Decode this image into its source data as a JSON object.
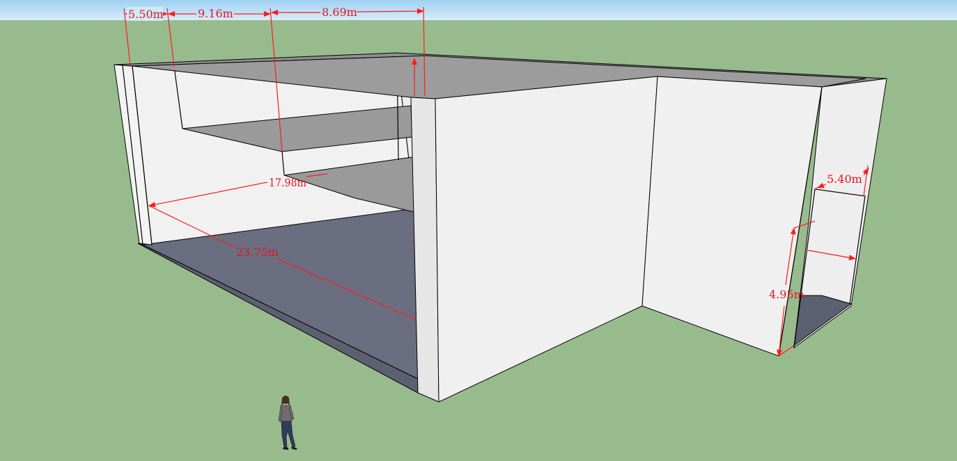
{
  "model": {
    "colors": {
      "sky": "#bfe0f6",
      "ground": "#98bb8e",
      "wall": "#efefef",
      "wall_shade": "#e4e4e4",
      "slab": "#9a9a9a",
      "floor": "#6b6e80",
      "dimension": "#ff1a1a"
    },
    "dimensions": [
      {
        "id": "dim-top-1",
        "label": "5.50m"
      },
      {
        "id": "dim-top-2",
        "label": "9.16m"
      },
      {
        "id": "dim-top-3",
        "label": "8.69m"
      },
      {
        "id": "dim-inner-width",
        "label": "17.98m"
      },
      {
        "id": "dim-inner-length",
        "label": "23.75m"
      },
      {
        "id": "dim-opening-width",
        "label": "5.40m"
      },
      {
        "id": "dim-opening-height",
        "label": "4.95m"
      }
    ],
    "figure": "scale-figure"
  }
}
